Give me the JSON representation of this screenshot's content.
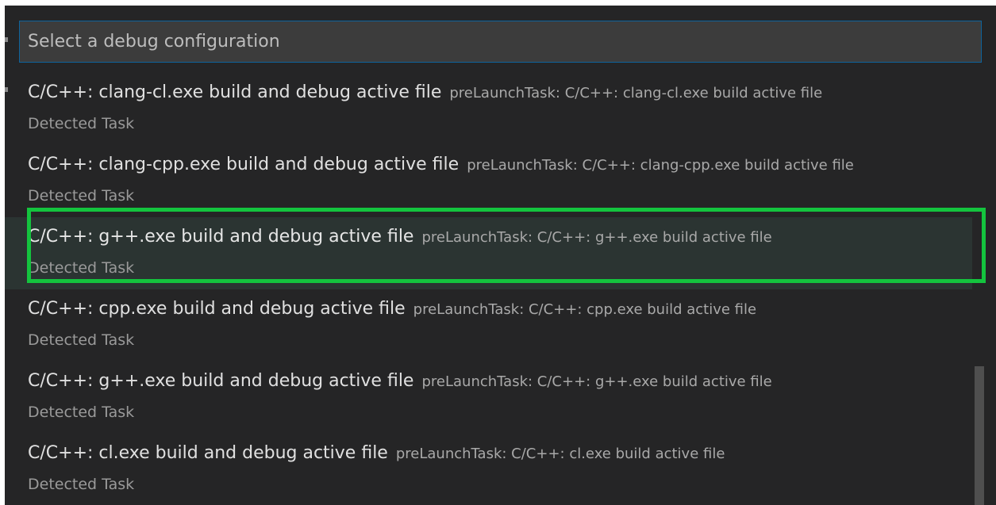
{
  "quick_pick": {
    "placeholder": "Select a debug configuration",
    "items": [
      {
        "label": "C/C++: clang-cl.exe build and debug active file",
        "description": "preLaunchTask: C/C++: clang-cl.exe build active file",
        "detail": "Detected Task"
      },
      {
        "label": "C/C++: clang-cpp.exe build and debug active file",
        "description": "preLaunchTask: C/C++: clang-cpp.exe build active file",
        "detail": "Detected Task"
      },
      {
        "label": "C/C++: g++.exe build and debug active file",
        "description": "preLaunchTask: C/C++: g++.exe build active file",
        "detail": "Detected Task"
      },
      {
        "label": "C/C++: cpp.exe build and debug active file",
        "description": "preLaunchTask: C/C++: cpp.exe build active file",
        "detail": "Detected Task"
      },
      {
        "label": "C/C++: g++.exe build and debug active file",
        "description": "preLaunchTask: C/C++: g++.exe build active file",
        "detail": "Detected Task"
      },
      {
        "label": "C/C++: cl.exe build and debug active file",
        "description": "preLaunchTask: C/C++: cl.exe build active file",
        "detail": "Detected Task"
      }
    ]
  },
  "colors": {
    "background": "#252526",
    "input_background": "#3c3c3c",
    "input_border": "#0e639c",
    "highlight_border": "#14c43e",
    "active_row": "#2b3432"
  }
}
